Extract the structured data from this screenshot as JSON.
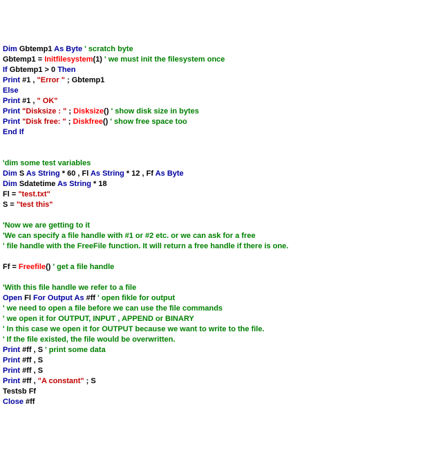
{
  "lines": [
    {
      "id": "l01",
      "segs": [
        {
          "c": "kw",
          "t": "Dim"
        },
        {
          "c": "id",
          "t": " Gbtemp1 "
        },
        {
          "c": "kw",
          "t": "As"
        },
        {
          "c": "kw",
          "t": " Byte"
        },
        {
          "c": "id",
          "t": " "
        },
        {
          "c": "cm",
          "t": "' scratch byte"
        }
      ]
    },
    {
      "id": "l02",
      "segs": [
        {
          "c": "id",
          "t": "Gbtemp1 = "
        },
        {
          "c": "fn",
          "t": "Initfilesystem"
        },
        {
          "c": "id",
          "t": "(1) "
        },
        {
          "c": "cm",
          "t": "' we must init the filesystem once"
        }
      ]
    },
    {
      "id": "l03",
      "segs": [
        {
          "c": "kw",
          "t": "If"
        },
        {
          "c": "id",
          "t": " Gbtemp1 > 0 "
        },
        {
          "c": "kw",
          "t": "Then"
        }
      ]
    },
    {
      "id": "l04",
      "segs": [
        {
          "c": "kw",
          "t": "Print"
        },
        {
          "c": "id",
          "t": " #1 , "
        },
        {
          "c": "s",
          "t": "\"Error \""
        },
        {
          "c": "id",
          "t": " ; Gbtemp1"
        }
      ]
    },
    {
      "id": "l05",
      "segs": [
        {
          "c": "kw",
          "t": "Else"
        }
      ]
    },
    {
      "id": "l06",
      "segs": [
        {
          "c": "kw",
          "t": "Print"
        },
        {
          "c": "id",
          "t": " #1 , "
        },
        {
          "c": "s",
          "t": "\" OK\""
        }
      ]
    },
    {
      "id": "l07",
      "segs": [
        {
          "c": "kw",
          "t": "Print"
        },
        {
          "c": "id",
          "t": " "
        },
        {
          "c": "s",
          "t": "\"Disksize : \""
        },
        {
          "c": "id",
          "t": " ; "
        },
        {
          "c": "fn",
          "t": "Disksize"
        },
        {
          "c": "id",
          "t": "() "
        },
        {
          "c": "cm",
          "t": "' show disk size in bytes"
        }
      ]
    },
    {
      "id": "l08",
      "segs": [
        {
          "c": "kw",
          "t": "Print"
        },
        {
          "c": "id",
          "t": " "
        },
        {
          "c": "s",
          "t": "\"Disk free: \""
        },
        {
          "c": "id",
          "t": " ; "
        },
        {
          "c": "fn",
          "t": "Diskfree"
        },
        {
          "c": "id",
          "t": "() "
        },
        {
          "c": "cm",
          "t": "' show free space too"
        }
      ]
    },
    {
      "id": "l09",
      "segs": [
        {
          "c": "kw",
          "t": "End"
        },
        {
          "c": "id",
          "t": " "
        },
        {
          "c": "kw",
          "t": "If"
        }
      ]
    },
    {
      "id": "l10",
      "segs": [
        {
          "c": "id",
          "t": " "
        }
      ]
    },
    {
      "id": "l11",
      "segs": [
        {
          "c": "id",
          "t": " "
        }
      ]
    },
    {
      "id": "l12",
      "segs": [
        {
          "c": "cm",
          "t": "'dim some test variables"
        }
      ]
    },
    {
      "id": "l13",
      "segs": [
        {
          "c": "kw",
          "t": "Dim"
        },
        {
          "c": "id",
          "t": " S "
        },
        {
          "c": "kw",
          "t": "As"
        },
        {
          "c": "id",
          "t": " "
        },
        {
          "c": "kw",
          "t": "String"
        },
        {
          "c": "id",
          "t": " * 60 , Fl "
        },
        {
          "c": "kw",
          "t": "As"
        },
        {
          "c": "id",
          "t": " "
        },
        {
          "c": "kw",
          "t": "String"
        },
        {
          "c": "id",
          "t": " * 12 , Ff "
        },
        {
          "c": "kw",
          "t": "As"
        },
        {
          "c": "id",
          "t": " "
        },
        {
          "c": "kw",
          "t": "Byte"
        }
      ]
    },
    {
      "id": "l14",
      "segs": [
        {
          "c": "kw",
          "t": "Dim"
        },
        {
          "c": "id",
          "t": " Sdatetime "
        },
        {
          "c": "kw",
          "t": "As"
        },
        {
          "c": "id",
          "t": " "
        },
        {
          "c": "kw",
          "t": "String"
        },
        {
          "c": "id",
          "t": " * 18"
        }
      ]
    },
    {
      "id": "l15",
      "segs": [
        {
          "c": "id",
          "t": "Fl = "
        },
        {
          "c": "s",
          "t": "\"test.txt\""
        }
      ]
    },
    {
      "id": "l16",
      "segs": [
        {
          "c": "id",
          "t": "S = "
        },
        {
          "c": "s",
          "t": "\"test this\""
        }
      ]
    },
    {
      "id": "l17",
      "segs": [
        {
          "c": "id",
          "t": " "
        }
      ]
    },
    {
      "id": "l18",
      "segs": [
        {
          "c": "cm",
          "t": "'Now we are getting to it"
        }
      ]
    },
    {
      "id": "l19",
      "segs": [
        {
          "c": "cm",
          "t": "'We can specify a file handle with #1 or #2 etc. or we can ask for a free"
        }
      ]
    },
    {
      "id": "l20",
      "segs": [
        {
          "c": "cm",
          "t": "' file handle with the FreeFile function. It will return a free handle if there is one."
        }
      ]
    },
    {
      "id": "l21",
      "segs": [
        {
          "c": "id",
          "t": " "
        }
      ]
    },
    {
      "id": "l22",
      "segs": [
        {
          "c": "id",
          "t": "Ff = "
        },
        {
          "c": "fn",
          "t": "Freefile"
        },
        {
          "c": "id",
          "t": "() "
        },
        {
          "c": "cm",
          "t": "' get a file handle"
        }
      ]
    },
    {
      "id": "l23",
      "segs": [
        {
          "c": "id",
          "t": " "
        }
      ]
    },
    {
      "id": "l24",
      "segs": [
        {
          "c": "cm",
          "t": "'With this file handle we refer to a file"
        }
      ]
    },
    {
      "id": "l25",
      "segs": [
        {
          "c": "kw",
          "t": "Open"
        },
        {
          "c": "id",
          "t": " Fl "
        },
        {
          "c": "kw",
          "t": "For"
        },
        {
          "c": "id",
          "t": " "
        },
        {
          "c": "kw",
          "t": "Output"
        },
        {
          "c": "id",
          "t": " "
        },
        {
          "c": "kw",
          "t": "As"
        },
        {
          "c": "id",
          "t": " #ff "
        },
        {
          "c": "cm",
          "t": "' open fikle for output"
        }
      ]
    },
    {
      "id": "l26",
      "segs": [
        {
          "c": "cm",
          "t": "' we need to open a file before we can use the file commands"
        }
      ]
    },
    {
      "id": "l27",
      "segs": [
        {
          "c": "cm",
          "t": "' we open it for OUTPUT, INPUT , APPEND or BINARY"
        }
      ]
    },
    {
      "id": "l28",
      "segs": [
        {
          "c": "cm",
          "t": "' In this case we open it for OUTPUT because we want to write to the file."
        }
      ]
    },
    {
      "id": "l29",
      "segs": [
        {
          "c": "cm",
          "t": "' If the file existed, the file would be overwritten."
        }
      ]
    },
    {
      "id": "l30",
      "segs": [
        {
          "c": "kw",
          "t": "Print"
        },
        {
          "c": "id",
          "t": " #ff , S "
        },
        {
          "c": "cm",
          "t": "' print some data"
        }
      ]
    },
    {
      "id": "l31",
      "segs": [
        {
          "c": "kw",
          "t": "Print"
        },
        {
          "c": "id",
          "t": " #ff , S"
        }
      ]
    },
    {
      "id": "l32",
      "segs": [
        {
          "c": "kw",
          "t": "Print"
        },
        {
          "c": "id",
          "t": " #ff , S"
        }
      ]
    },
    {
      "id": "l33",
      "segs": [
        {
          "c": "kw",
          "t": "Print"
        },
        {
          "c": "id",
          "t": " #ff , "
        },
        {
          "c": "s",
          "t": "\"A constant\""
        },
        {
          "c": "id",
          "t": " ; S"
        }
      ]
    },
    {
      "id": "l34",
      "segs": [
        {
          "c": "id",
          "t": "Testsb Ff"
        }
      ]
    },
    {
      "id": "l35",
      "segs": [
        {
          "c": "kw",
          "t": "Close"
        },
        {
          "c": "id",
          "t": " #ff"
        }
      ]
    }
  ]
}
